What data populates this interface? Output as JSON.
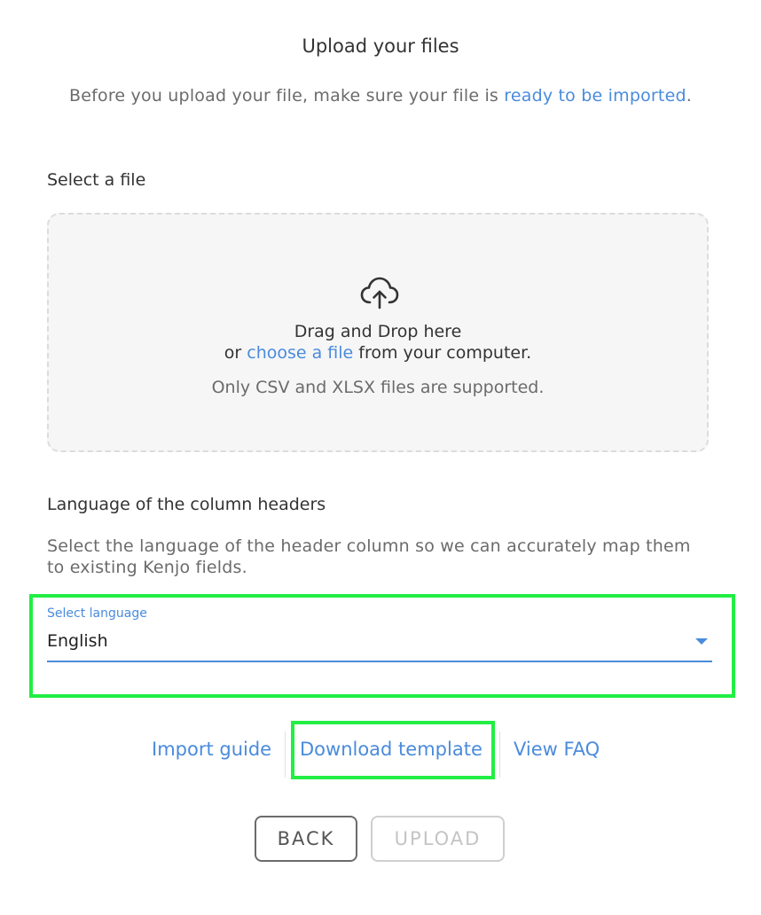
{
  "header": {
    "title": "Upload your files",
    "intro_text": "Before you upload your file, make sure your file is ",
    "intro_link": "ready to be imported",
    "intro_end": "."
  },
  "file_section": {
    "label": "Select a file",
    "dropzone": {
      "icon": "cloud-upload-icon",
      "line1": "Drag and Drop here",
      "line2_prefix": "or ",
      "line2_link": "choose a file",
      "line2_suffix": " from your computer.",
      "note": "Only CSV and XLSX files are supported."
    }
  },
  "language_section": {
    "label": "Language of the column headers",
    "description": "Select the language of the header column so we can accurately map them to existing Kenjo fields.",
    "select": {
      "label": "Select language",
      "value": "English"
    }
  },
  "links": {
    "import_guide": "Import guide",
    "download_template": "Download template",
    "view_faq": "View FAQ"
  },
  "buttons": {
    "back": "BACK",
    "upload": "UPLOAD"
  },
  "colors": {
    "link": "#4a8bdc",
    "highlight": "#22ee44"
  }
}
